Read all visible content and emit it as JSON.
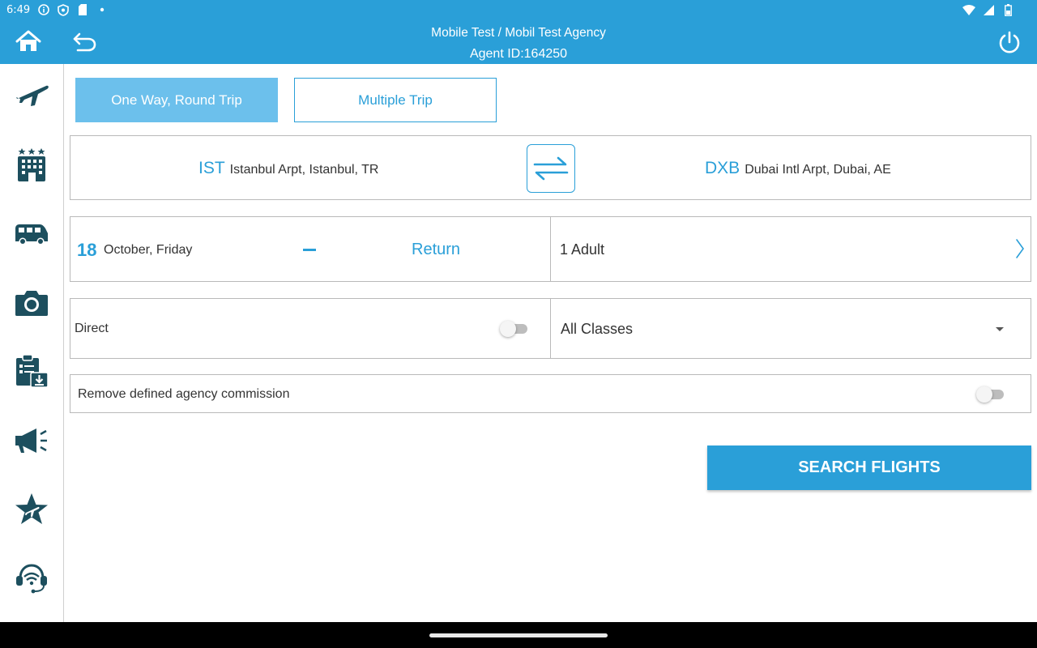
{
  "status_bar": {
    "time": "6:49",
    "icons": [
      "info-icon",
      "shield-icon",
      "sd-card-icon",
      "dot-icon"
    ],
    "right_icons": [
      "wifi-icon",
      "signal-icon",
      "battery-icon"
    ]
  },
  "header": {
    "title": "Mobile Test / Mobil Test Agency",
    "agent": "Agent ID:164250"
  },
  "sidebar": {
    "items": [
      {
        "name": "flights",
        "icon": "airplane-icon"
      },
      {
        "name": "hotels",
        "icon": "hotel-icon"
      },
      {
        "name": "transfers",
        "icon": "van-icon"
      },
      {
        "name": "tours",
        "icon": "camera-icon"
      },
      {
        "name": "bookings",
        "icon": "clipboard-download-icon"
      },
      {
        "name": "announcements",
        "icon": "megaphone-icon"
      },
      {
        "name": "favorites",
        "icon": "star-plane-icon"
      },
      {
        "name": "support",
        "icon": "headset-icon"
      }
    ]
  },
  "trip_tabs": {
    "one_way_round_trip": "One Way, Round Trip",
    "multiple_trip": "Multiple Trip"
  },
  "route": {
    "from_code": "IST",
    "from_city": "Istanbul Arpt, Istanbul, TR",
    "to_code": "DXB",
    "to_city": "Dubai Intl Arpt, Dubai, AE"
  },
  "dates": {
    "depart_day": "18",
    "depart_text": "October, Friday",
    "return_label": "Return"
  },
  "passengers": {
    "label": "1 Adult"
  },
  "direct": {
    "label": "Direct",
    "enabled": false
  },
  "cabin_class": {
    "selected": "All Classes"
  },
  "commission": {
    "label": "Remove defined agency commission",
    "enabled": false
  },
  "actions": {
    "search_label": "SEARCH FLIGHTS"
  },
  "colors": {
    "primary": "#2a9fd8",
    "tab_active": "#6cc0ec",
    "icon_dark": "#1d4f5e"
  }
}
